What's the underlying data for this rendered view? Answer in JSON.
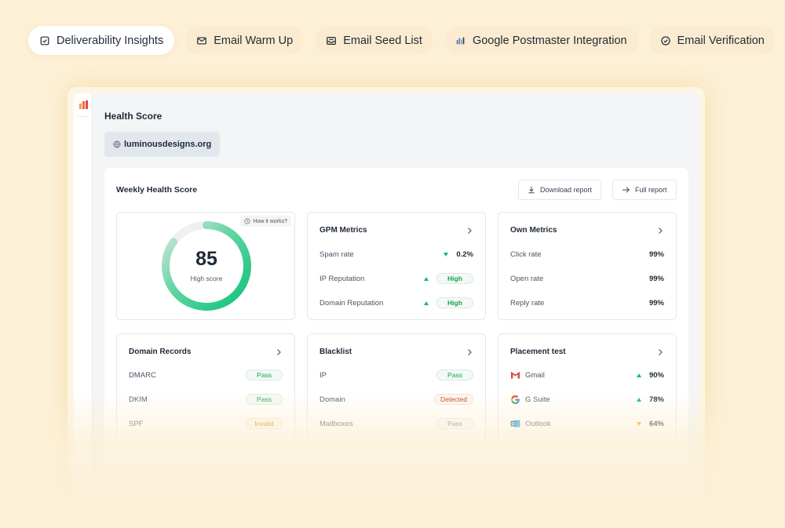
{
  "tabs": [
    {
      "label": "Deliverability Insights",
      "icon": "checkbox-icon",
      "active": true
    },
    {
      "label": "Email Warm Up",
      "icon": "mail-icon",
      "active": false
    },
    {
      "label": "Email Seed List",
      "icon": "inbox-icon",
      "active": false
    },
    {
      "label": "Google Postmaster Integration",
      "icon": "postmaster-logo-icon",
      "active": false
    },
    {
      "label": "Email Verification",
      "icon": "check-circle-icon",
      "active": false
    }
  ],
  "page": {
    "title": "Health Score",
    "domain": "luminousdesigns.org"
  },
  "panel": {
    "title": "Weekly Health Score",
    "download_label": "Download report",
    "full_report_label": "Full report"
  },
  "score_card": {
    "how_label": "How it works?",
    "score": "85",
    "score_fraction": 0.85,
    "label": "High score"
  },
  "gpm": {
    "title": "GPM Metrics",
    "rows": [
      {
        "label": "Spam rate",
        "value": "0.2%",
        "trend": "down"
      },
      {
        "label": "IP Reputation",
        "value": "High",
        "trend": "up"
      },
      {
        "label": "Domain Reputation",
        "value": "High",
        "trend": "up"
      }
    ]
  },
  "own": {
    "title": "Own Metrics",
    "rows": [
      {
        "label": "Click rate",
        "value": "99%"
      },
      {
        "label": "Open rate",
        "value": "99%"
      },
      {
        "label": "Reply rate",
        "value": "99%"
      }
    ]
  },
  "domain_records": {
    "title": "Domain Records",
    "rows": [
      {
        "label": "DMARC",
        "value": "Pass"
      },
      {
        "label": "DKIM",
        "value": "Pass"
      },
      {
        "label": "SPF",
        "value": "Invalid"
      }
    ]
  },
  "blacklist": {
    "title": "Blacklist",
    "rows": [
      {
        "label": "IP",
        "value": "Pass"
      },
      {
        "label": "Domain",
        "value": "Detected"
      },
      {
        "label": "Mailboxes",
        "value": "Pass"
      }
    ]
  },
  "placement": {
    "title": "Placement test",
    "rows": [
      {
        "label": "Gmail",
        "value": "90%",
        "trend": "up",
        "icon": "gmail-icon"
      },
      {
        "label": "G Suite",
        "value": "78%",
        "trend": "up",
        "icon": "google-icon"
      },
      {
        "label": "Outlook",
        "value": "64%",
        "trend": "down",
        "icon": "outlook-icon"
      }
    ]
  },
  "colors": {
    "background": "#fcf0d6",
    "accent_green": "#10b981",
    "warning_orange": "#f59e0b",
    "danger": "#c2410c"
  }
}
